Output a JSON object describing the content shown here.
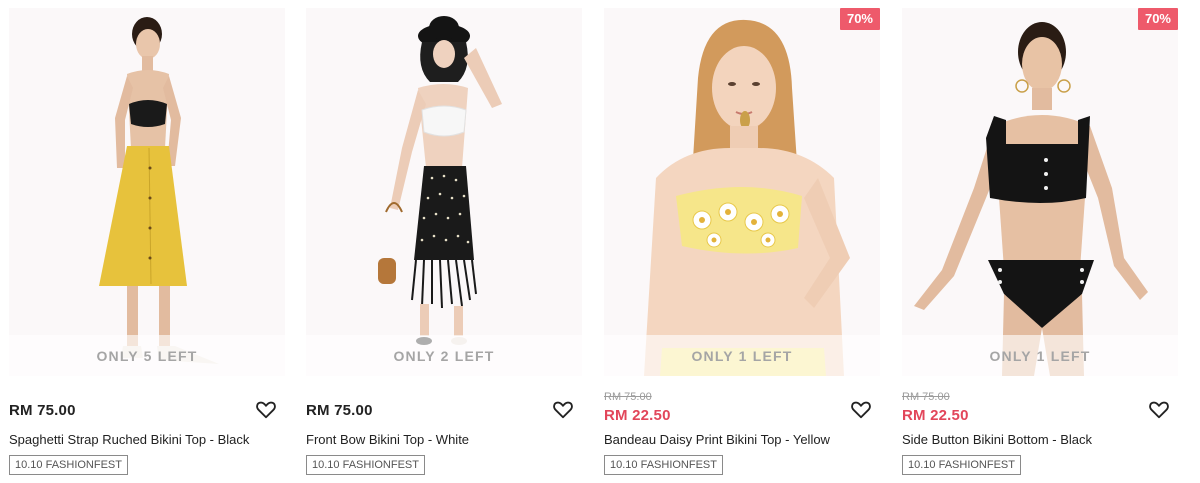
{
  "products": [
    {
      "stock_label": "ONLY 5 LEFT",
      "price": "RM 75.00",
      "name": "Spaghetti Strap Ruched Bikini Top - Black",
      "tag": "10.10 FASHIONFEST",
      "icon": "heart-outline-icon"
    },
    {
      "stock_label": "ONLY 2 LEFT",
      "price": "RM 75.00",
      "name": "Front Bow Bikini Top - White",
      "tag": "10.10 FASHIONFEST",
      "icon": "heart-outline-icon"
    },
    {
      "discount": "70%",
      "stock_label": "ONLY 1 LEFT",
      "old_price": "RM 75.00",
      "sale_price": "RM 22.50",
      "name": "Bandeau Daisy Print Bikini Top - Yellow",
      "tag": "10.10 FASHIONFEST",
      "icon": "heart-outline-icon"
    },
    {
      "discount": "70%",
      "stock_label": "ONLY 1 LEFT",
      "old_price": "RM 75.00",
      "sale_price": "RM 22.50",
      "name": "Side Button Bikini Bottom - Black",
      "tag": "10.10 FASHIONFEST",
      "icon": "heart-outline-icon"
    }
  ],
  "colors": {
    "sale": "#e2465a",
    "discount_badge": "#ee5a6b",
    "stock_text": "#a5a5a5",
    "image_bg": "#fbf8f9"
  }
}
